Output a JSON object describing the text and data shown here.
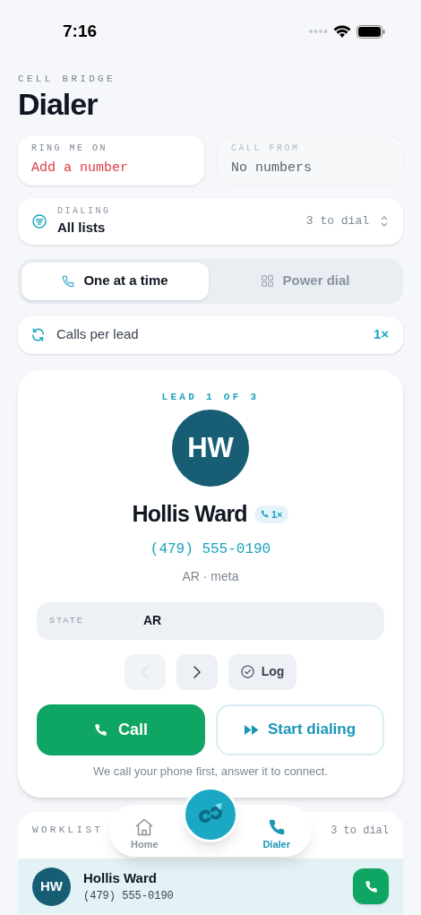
{
  "status_bar": {
    "time": "7:16"
  },
  "header": {
    "eyebrow": "CELL BRIDGE",
    "title": "Dialer"
  },
  "numbers": [
    {
      "label": "RING ME ON",
      "value": "Add a number",
      "kind": "missing"
    },
    {
      "label": "CALL FROM",
      "value": "No numbers",
      "kind": "empty"
    }
  ],
  "dialing": {
    "label": "DIALING",
    "value": "All lists",
    "count": "3 to dial"
  },
  "modes": [
    {
      "label": "One at a time",
      "selected": true,
      "kind": "phone"
    },
    {
      "label": "Power dial",
      "selected": false,
      "kind": "grid"
    }
  ],
  "calls_per_lead": {
    "label": "Calls per lead",
    "value": "1×"
  },
  "lead": {
    "position": "LEAD 1 OF 3",
    "initials": "HW",
    "name": "Hollis Ward",
    "badge": "1×",
    "phone": "(479) 555-0190",
    "meta": "AR · meta",
    "fields": [
      {
        "label": "STATE",
        "value": "AR"
      }
    ],
    "nav": [
      {
        "kind": "prev",
        "disabled": true
      },
      {
        "kind": "next",
        "disabled": false
      }
    ],
    "log_button": "Log",
    "call_button": "Call",
    "start_button": "Start dialing",
    "hint": "We call your phone first, answer it to connect."
  },
  "worklist": {
    "title": "WORKLIST",
    "count": "3 to dial",
    "rows": [
      {
        "initials": "HW",
        "name": "Hollis Ward",
        "phone": "(479) 555-0190",
        "selected": true
      }
    ]
  },
  "tab_bar": [
    {
      "label": "Home",
      "kind": "home",
      "selected": false
    },
    {
      "label": "Dialer",
      "kind": "phone",
      "selected": true
    }
  ]
}
